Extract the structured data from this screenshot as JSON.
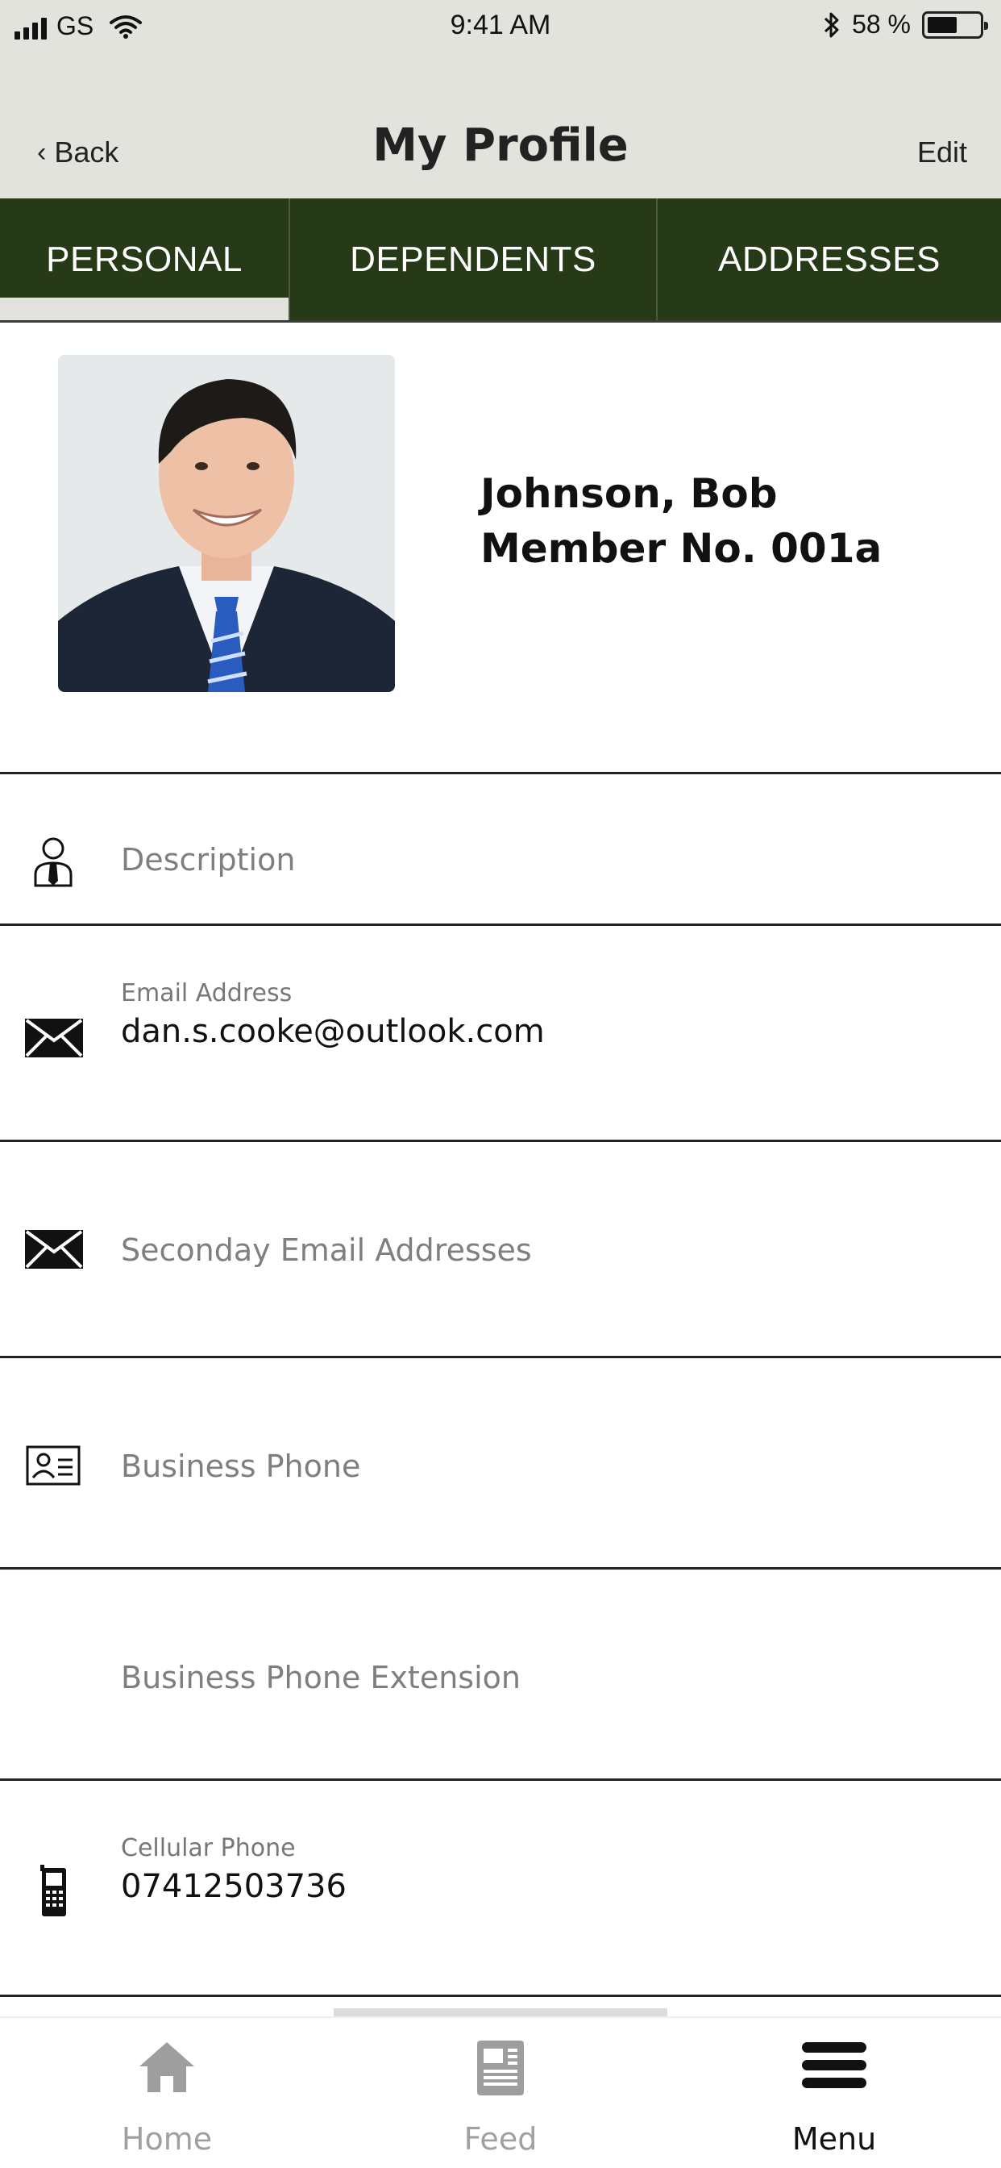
{
  "status_bar": {
    "carrier": "GS",
    "time": "9:41 AM",
    "battery_percent": "58 %",
    "battery_level": 0.58
  },
  "nav": {
    "back_label": "Back",
    "title": "My Profile",
    "edit_label": "Edit"
  },
  "tabs": [
    {
      "label": "PERSONAL",
      "selected": true
    },
    {
      "label": "DEPENDENTS",
      "selected": false
    },
    {
      "label": "ADDRESSES",
      "selected": false
    }
  ],
  "profile": {
    "name": "Johnson, Bob",
    "member_no": "Member No. 001a"
  },
  "fields": {
    "description": {
      "placeholder": "Description",
      "icon": "person-tie-icon"
    },
    "email": {
      "label": "Email Address",
      "value": "dan.s.cooke@outlook.com",
      "icon": "envelope-icon"
    },
    "secondary_email": {
      "placeholder": "Seconday Email Addresses",
      "icon": "envelope-icon"
    },
    "business_phone": {
      "placeholder": "Business Phone",
      "icon": "contact-card-icon"
    },
    "business_phone_ext": {
      "placeholder": "Business Phone Extension"
    },
    "cellular_phone": {
      "label": "Cellular Phone",
      "value": "07412503736",
      "icon": "mobile-phone-icon"
    }
  },
  "bottom_tabs": [
    {
      "label": "Home",
      "icon": "home-icon",
      "active": false
    },
    {
      "label": "Feed",
      "icon": "newspaper-icon",
      "active": false
    },
    {
      "label": "Menu",
      "icon": "hamburger-menu-icon",
      "active": true
    }
  ],
  "colors": {
    "header_bg": "#e2e3dc",
    "tab_bg": "#263a17",
    "text_muted": "#7f7f7f"
  }
}
